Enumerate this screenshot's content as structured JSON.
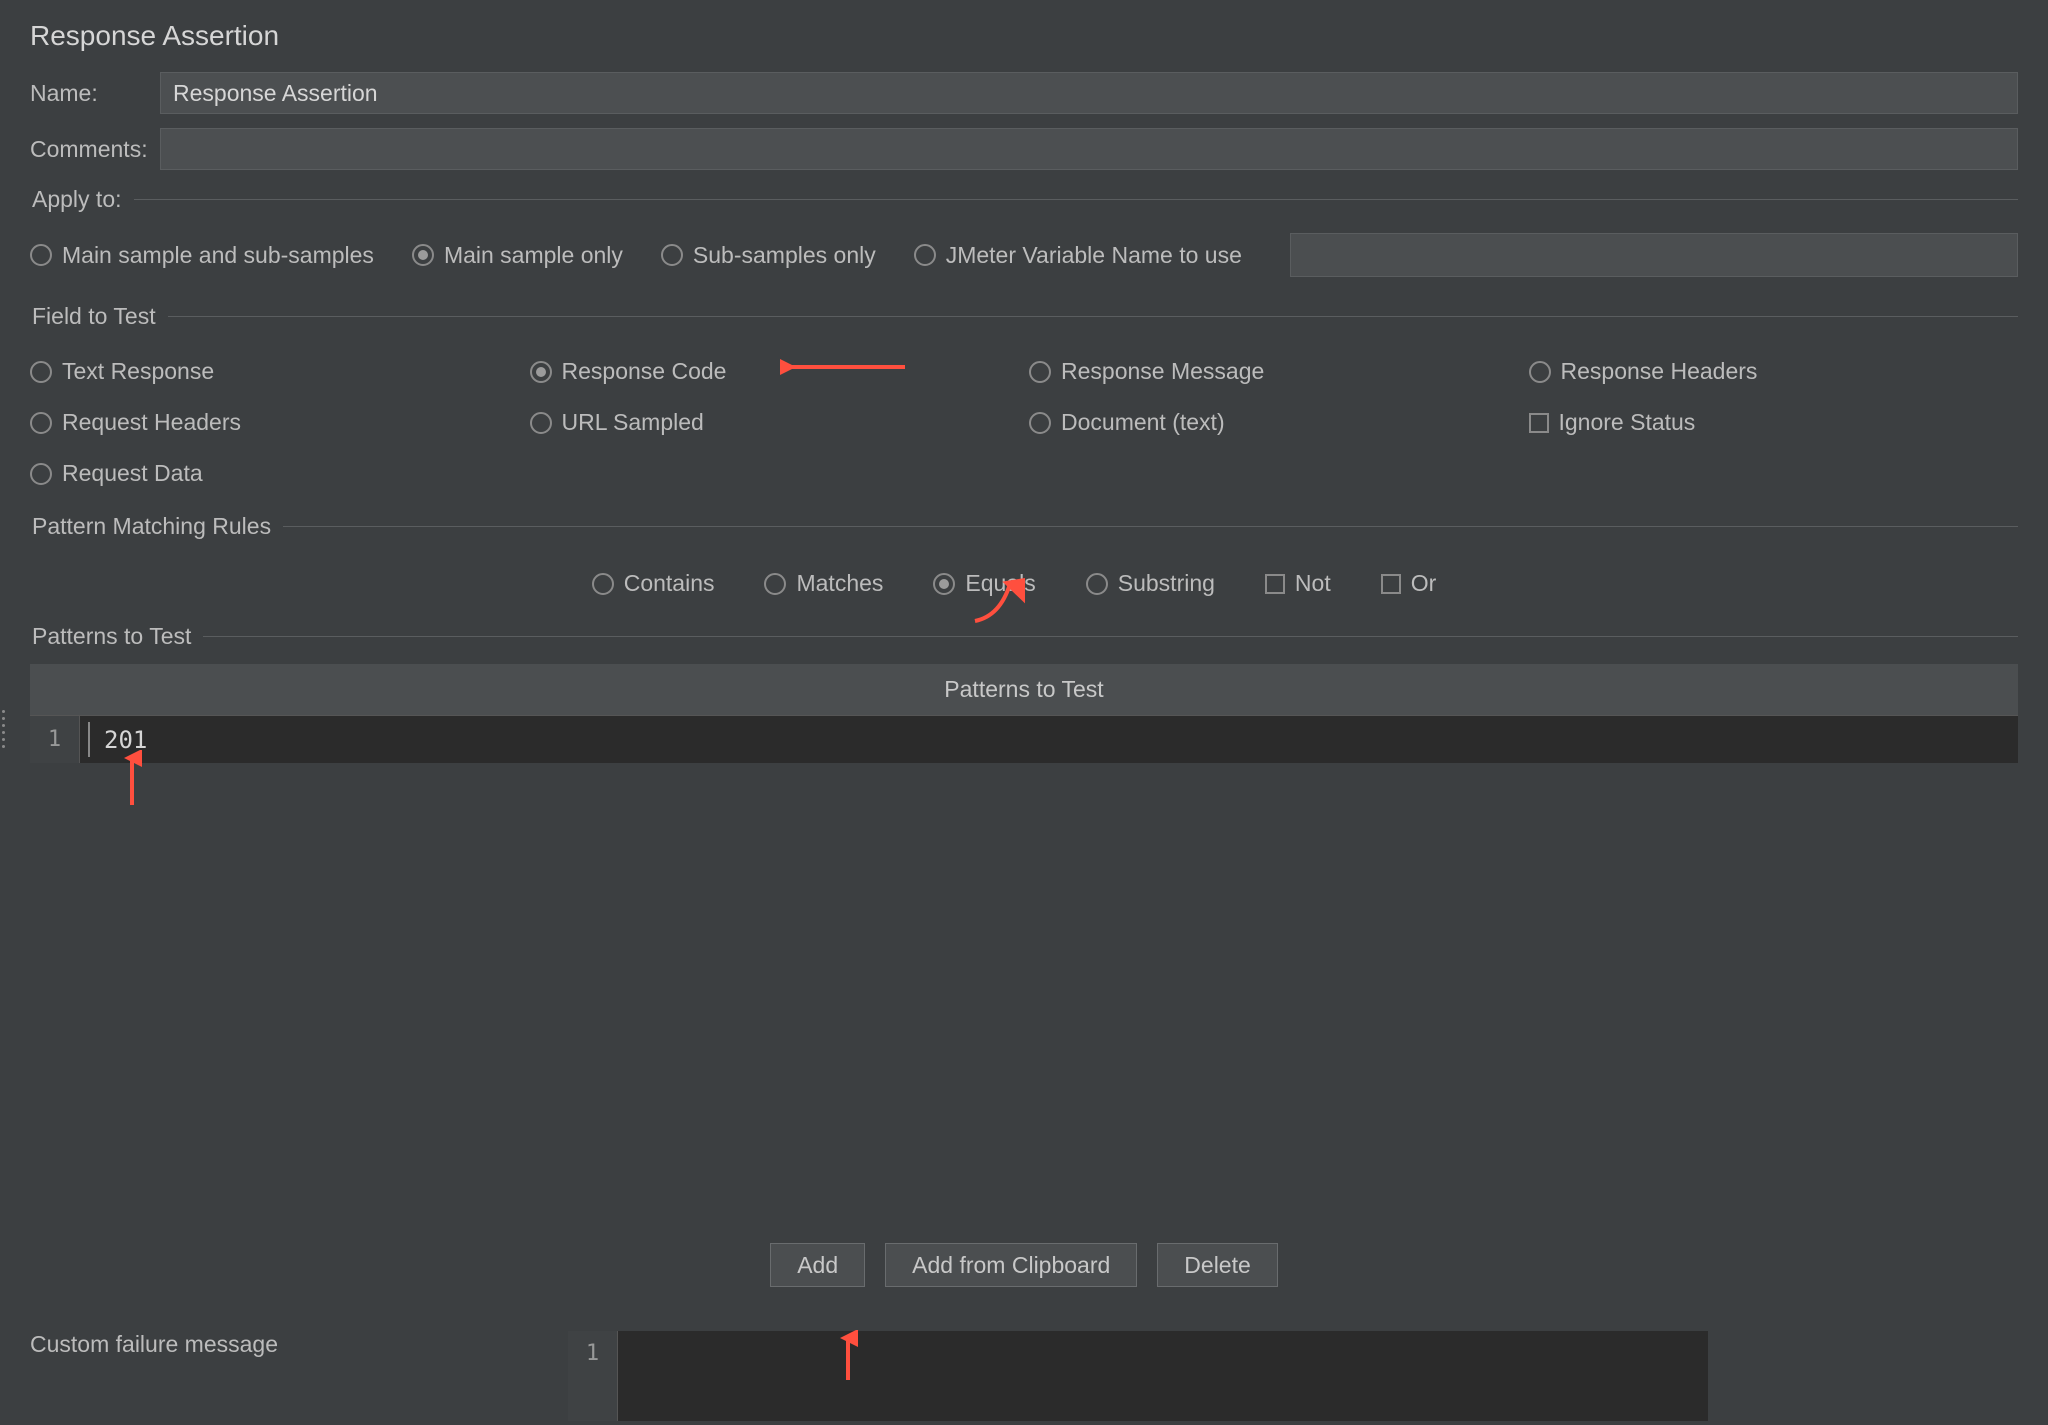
{
  "title": "Response Assertion",
  "name_label": "Name:",
  "name_value": "Response Assertion",
  "comments_label": "Comments:",
  "comments_value": "",
  "apply_to": {
    "legend": "Apply to:",
    "options": {
      "main_sub": "Main sample and sub-samples",
      "main_only": "Main sample only",
      "sub_only": "Sub-samples only",
      "jmeter_var": "JMeter Variable Name to use"
    },
    "selected": "main_only",
    "jmeter_var_value": ""
  },
  "field_to_test": {
    "legend": "Field to Test",
    "options": {
      "text_response": "Text Response",
      "response_code": "Response Code",
      "response_message": "Response Message",
      "response_headers": "Response Headers",
      "request_headers": "Request Headers",
      "url_sampled": "URL Sampled",
      "document_text": "Document (text)",
      "ignore_status": "Ignore Status",
      "request_data": "Request Data"
    },
    "selected": "response_code",
    "ignore_status_checked": false
  },
  "pattern_matching": {
    "legend": "Pattern Matching Rules",
    "options": {
      "contains": "Contains",
      "matches": "Matches",
      "equals": "Equals",
      "substring": "Substring"
    },
    "selected": "equals",
    "not_label": "Not",
    "not_checked": false,
    "or_label": "Or",
    "or_checked": false
  },
  "patterns": {
    "legend": "Patterns to Test",
    "header": "Patterns to Test",
    "rows": [
      {
        "index": "1",
        "value": "201"
      }
    ]
  },
  "buttons": {
    "add": "Add",
    "add_clipboard": "Add from Clipboard",
    "delete": "Delete"
  },
  "custom_failure": {
    "label": "Custom failure message",
    "row_index": "1",
    "value": ""
  }
}
